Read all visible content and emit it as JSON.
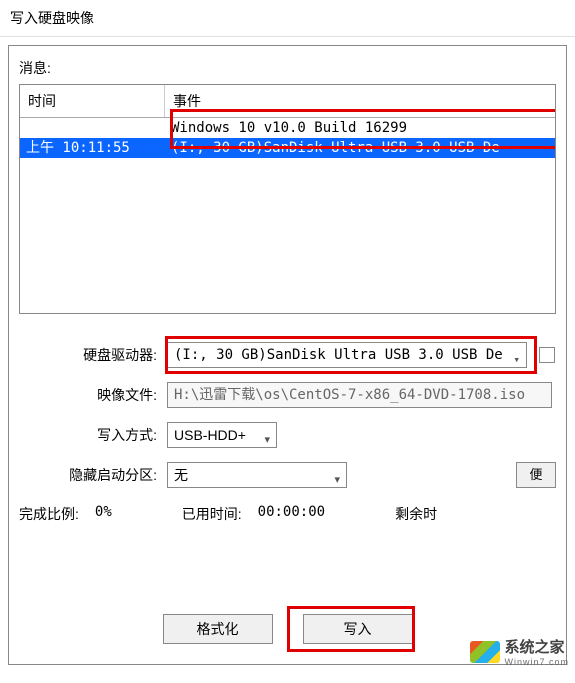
{
  "window": {
    "title": "写入硬盘映像"
  },
  "messages": {
    "label": "消息:",
    "headers": {
      "time": "时间",
      "event": "事件"
    },
    "rows": [
      {
        "time": "",
        "event": "Windows 10 v10.0 Build 16299"
      },
      {
        "time": "上午 10:11:55",
        "event": "(I:, 30 GB)SanDisk Ultra USB 3.0 USB De"
      }
    ]
  },
  "fields": {
    "drive": {
      "label": "硬盘驱动器:",
      "value": "(I:, 30 GB)SanDisk Ultra USB 3.0 USB De"
    },
    "image": {
      "label": "映像文件:",
      "value": "H:\\迅雷下载\\os\\CentOS-7-x86_64-DVD-1708.iso"
    },
    "write_mode": {
      "label": "写入方式:",
      "value": "USB-HDD+"
    },
    "hidden_boot": {
      "label": "隐藏启动分区:",
      "value": "无",
      "side_button": "便"
    }
  },
  "stats": {
    "progress": {
      "label": "完成比例:",
      "value": "0%"
    },
    "elapsed": {
      "label": "已用时间:",
      "value": "00:00:00"
    },
    "remain": {
      "label": "剩余时"
    }
  },
  "buttons": {
    "format": "格式化",
    "write": "写入"
  },
  "watermark": {
    "main": "系统之家",
    "sub": "Winwin7.com"
  }
}
